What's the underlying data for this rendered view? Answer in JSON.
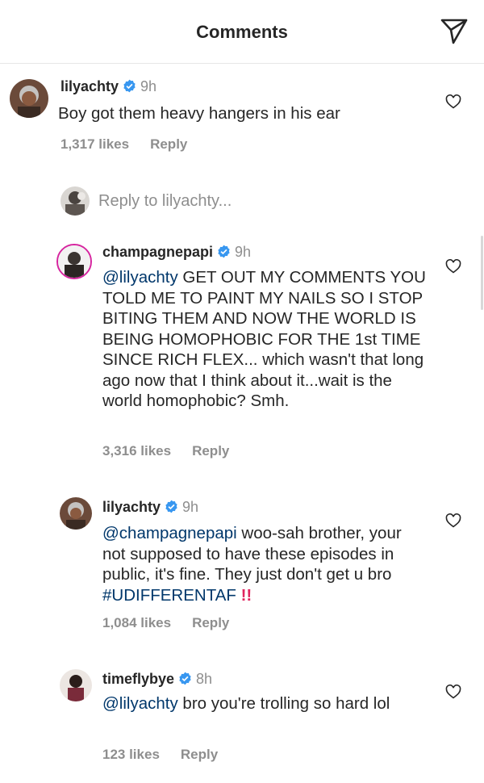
{
  "header": {
    "title": "Comments",
    "share_icon": "paper-plane-icon"
  },
  "comments": [
    {
      "username": "lilyachty",
      "time": "9h",
      "text": "Boy got them heavy hangers in his ear",
      "likes": "1,317 likes",
      "reply_label": "Reply"
    },
    {
      "username": "champagnepapi",
      "time": "9h",
      "mention": "@lilyachty",
      "text": " GET OUT MY COMMENTS YOU TOLD ME TO PAINT MY NAILS SO I STOP BITING THEM AND NOW THE WORLD IS BEING HOMOPHOBIC FOR THE 1st TIME SINCE RICH FLEX... which wasn't that long ago now that I think about it...wait is the world homophobic? Smh.",
      "likes": "3,316 likes",
      "reply_label": "Reply"
    },
    {
      "username": "lilyachty",
      "time": "9h",
      "mention": "@champagnepapi",
      "text": " woo-sah brother, your not supposed to have these episodes in public, it's fine. They just don't get u bro ",
      "hashtag": "#UDIFFERENTAF",
      "emoji": "!!",
      "likes": "1,084 likes",
      "reply_label": "Reply"
    },
    {
      "username": "timeflybye",
      "time": "8h",
      "mention": "@lilyachty",
      "text": " bro you're trolling so hard lol",
      "likes": "123 likes",
      "reply_label": "Reply"
    }
  ],
  "reply_input": {
    "placeholder": "Reply to lilyachty..."
  },
  "colors": {
    "verified": "#3897f0",
    "link": "#00376b",
    "muted": "#8e8e8e",
    "text": "#262626"
  }
}
